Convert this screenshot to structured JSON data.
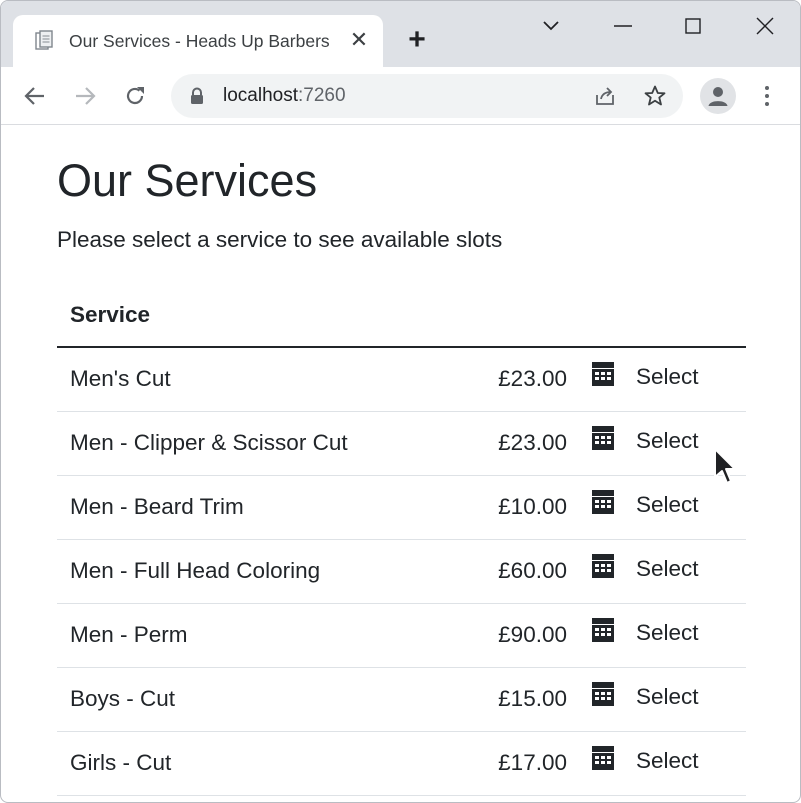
{
  "browser": {
    "tab": {
      "title": "Our Services - Heads Up Barbers",
      "close_symbol": "✕"
    },
    "new_tab_symbol": "+",
    "url": {
      "host": "localhost",
      "port": ":7260"
    }
  },
  "page": {
    "title": "Our Services",
    "subtitle": "Please select a service to see available slots",
    "table": {
      "header": "Service",
      "action_label": "Select",
      "rows": [
        {
          "name": "Men's Cut",
          "price": "£23.00"
        },
        {
          "name": "Men - Clipper & Scissor Cut",
          "price": "£23.00"
        },
        {
          "name": "Men - Beard Trim",
          "price": "£10.00"
        },
        {
          "name": "Men - Full Head Coloring",
          "price": "£60.00"
        },
        {
          "name": "Men - Perm",
          "price": "£90.00"
        },
        {
          "name": "Boys - Cut",
          "price": "£15.00"
        },
        {
          "name": "Girls - Cut",
          "price": "£17.00"
        }
      ]
    }
  },
  "icons": {
    "favicon": "document-favicon-icon",
    "row_action": "calendar-icon"
  },
  "colors": {
    "tabstrip": "#dee1e6",
    "omnibox": "#f1f3f4",
    "text": "#212529",
    "row_border": "#dee2e6"
  }
}
